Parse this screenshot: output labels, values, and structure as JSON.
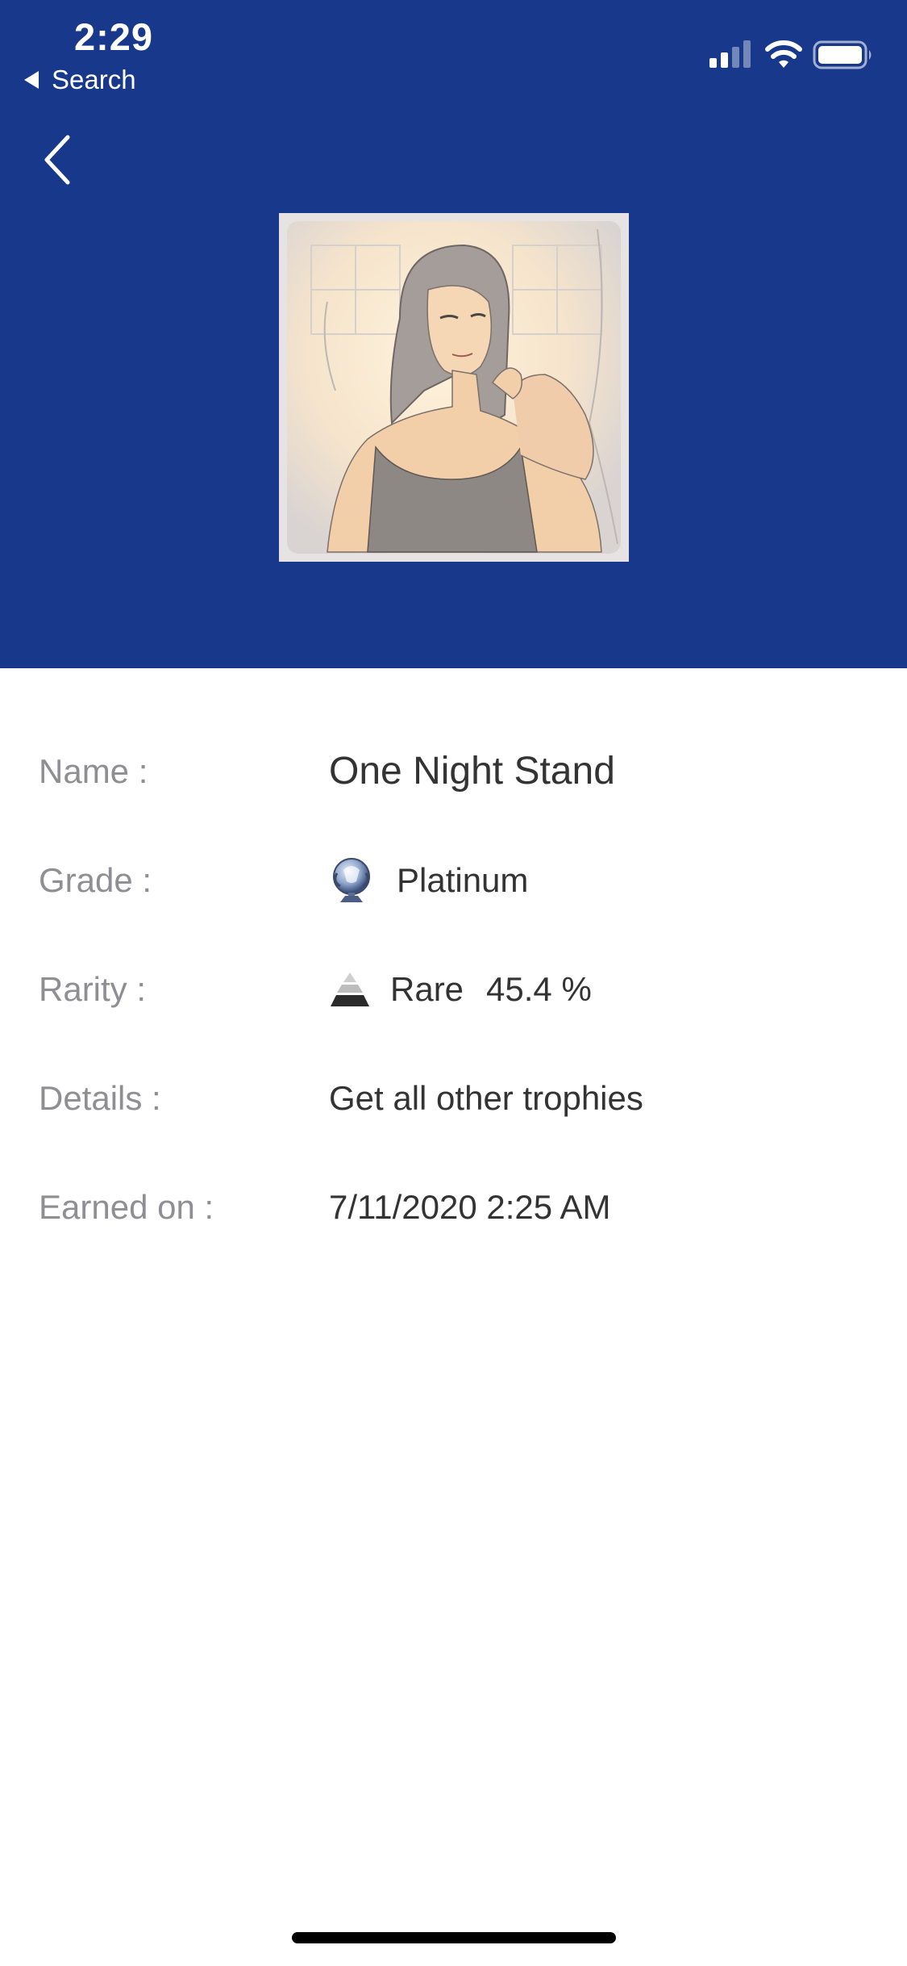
{
  "colors": {
    "header_bg": "#17388b",
    "label_text": "#8e8e93",
    "value_text": "#333333"
  },
  "status_bar": {
    "time": "2:29",
    "back_app_label": "Search",
    "icons": [
      "cellular-signal-icon",
      "wifi-icon",
      "battery-icon"
    ]
  },
  "nav": {
    "back_icon": "chevron-left-icon"
  },
  "trophy": {
    "image_description_icon": "trophy-artwork",
    "name_label": "Name :",
    "name_value": "One Night Stand",
    "grade_label": "Grade :",
    "grade_icon": "platinum-trophy-icon",
    "grade_value": "Platinum",
    "rarity_label": "Rarity :",
    "rarity_icon": "rarity-pyramid-icon",
    "rarity_value": "Rare",
    "rarity_percent": "45.4 %",
    "details_label": "Details :",
    "details_value": "Get all other trophies",
    "earned_label": "Earned on :",
    "earned_value": "7/11/2020 2:25 AM"
  }
}
